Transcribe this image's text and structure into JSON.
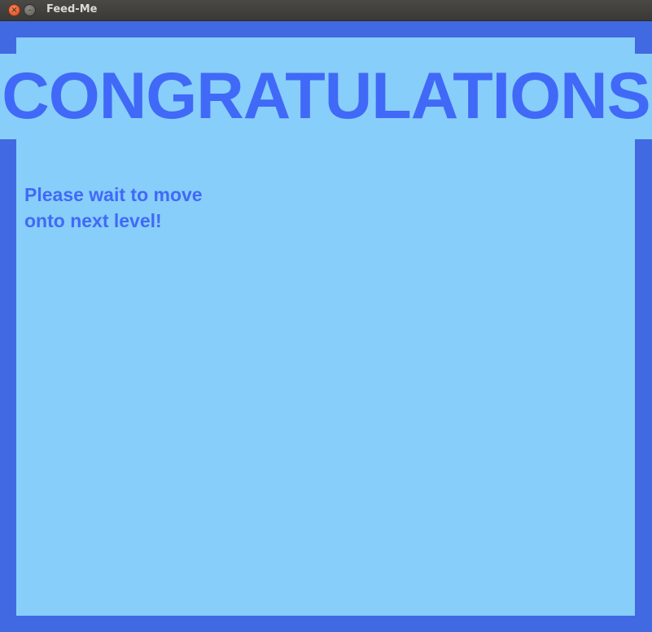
{
  "window": {
    "title": "Feed-Me",
    "close_glyph": "×",
    "minimize_glyph": "–"
  },
  "game": {
    "headline": "CONGRATULATIONS",
    "message_line1": "Please wait to move",
    "message_line2": "onto next level!"
  },
  "colors": {
    "border": "#4169E1",
    "background": "#87CEFA",
    "text": "#4169F7"
  }
}
